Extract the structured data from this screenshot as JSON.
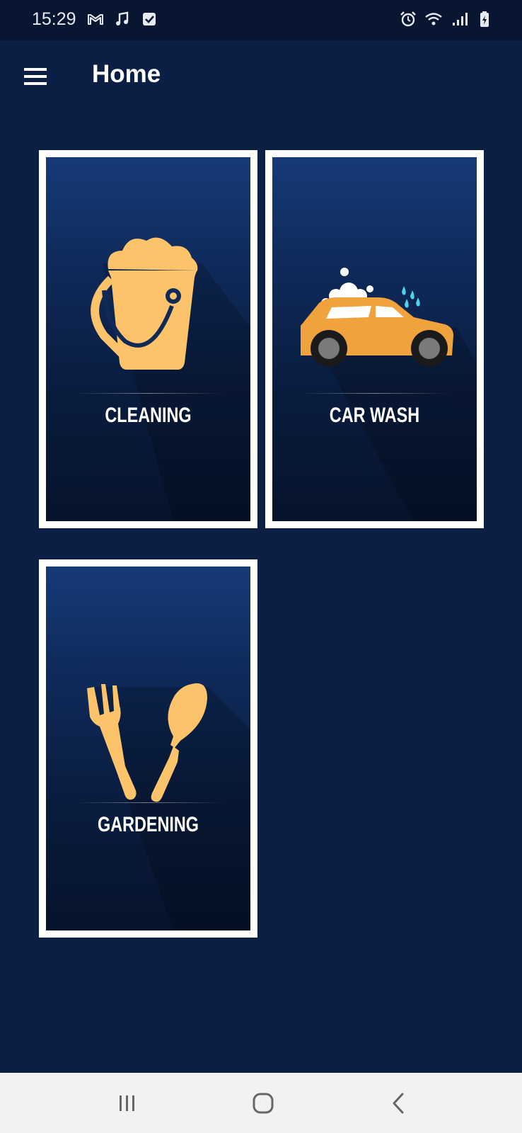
{
  "status_bar": {
    "time": "15:29",
    "left_icons": [
      "gmail-icon",
      "music-note-icon",
      "checkbox-icon"
    ],
    "right_icons": [
      "alarm-icon",
      "wifi-icon",
      "signal-icon",
      "battery-charging-icon"
    ]
  },
  "app_bar": {
    "title": "Home",
    "menu_icon": "hamburger-menu-icon"
  },
  "services": [
    {
      "label": "CLEANING",
      "icon": "bucket-icon"
    },
    {
      "label": "CAR WASH",
      "icon": "car-wash-icon"
    },
    {
      "label": "GARDENING",
      "icon": "garden-tools-icon"
    }
  ],
  "nav_bar": {
    "buttons": [
      "recents-icon",
      "home-icon",
      "back-icon"
    ]
  },
  "colors": {
    "background": "#0b1f44",
    "status_bar": "#081631",
    "tile_border": "#ffffff",
    "icon_accent": "#fcc36a",
    "car_body": "#f0a33c",
    "nav_bar": "#f2f2f2"
  }
}
